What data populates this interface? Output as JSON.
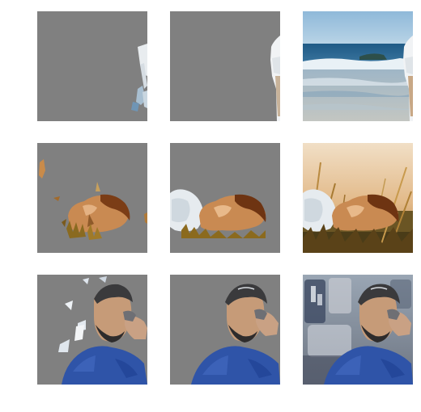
{
  "figure": {
    "rows": [
      {
        "subject": "person-on-beach",
        "tiles": [
          {
            "kind": "predicted-mask",
            "background": "#808080"
          },
          {
            "kind": "ground-truth-mask",
            "background": "#808080"
          },
          {
            "kind": "original-image",
            "background": "#6f9cc0"
          }
        ]
      },
      {
        "subject": "man-lying-in-grass",
        "tiles": [
          {
            "kind": "predicted-mask",
            "background": "#808080"
          },
          {
            "kind": "ground-truth-mask",
            "background": "#808080"
          },
          {
            "kind": "original-image",
            "background": "#d9b389"
          }
        ]
      },
      {
        "subject": "man-getting-haircut",
        "tiles": [
          {
            "kind": "predicted-mask",
            "background": "#808080"
          },
          {
            "kind": "ground-truth-mask",
            "background": "#808080"
          },
          {
            "kind": "original-image",
            "background": "#7f8a99"
          }
        ]
      }
    ],
    "colors": {
      "mask_gray": "#808080",
      "page_background": "#ffffff"
    }
  }
}
